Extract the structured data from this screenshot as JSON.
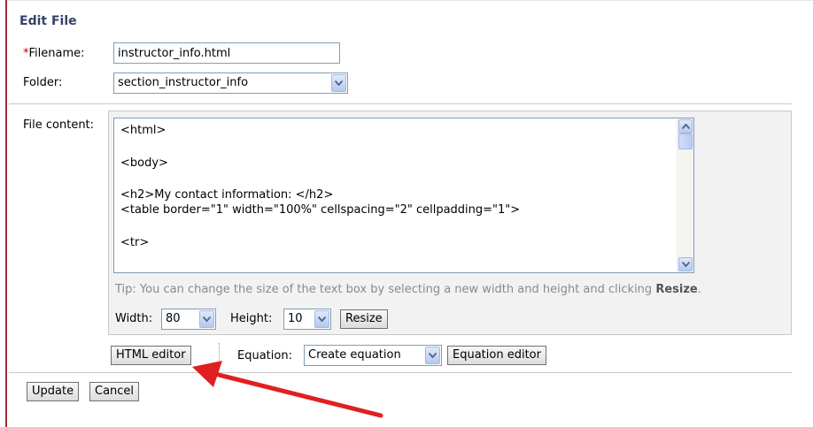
{
  "page": {
    "title": "Edit File"
  },
  "filename": {
    "required_marker": "*",
    "label": "Filename:",
    "value": "instructor_info.html"
  },
  "folder": {
    "label": "Folder:",
    "value": "section_instructor_info"
  },
  "file_content": {
    "label": "File content:",
    "lines": [
      "<html>",
      "<body>",
      "<h2>My contact information: </h2>",
      "<table border=\"1\" width=\"100%\" cellspacing=\"2\" cellpadding=\"1\">",
      "<tr>"
    ],
    "tip_prefix": "Tip: You can change the size of the text box by selecting a new width and height and clicking ",
    "tip_bold": "Resize",
    "tip_suffix": ".",
    "width_label": "Width:",
    "width_value": "80",
    "height_label": "Height:",
    "height_value": "10",
    "resize_label": "Resize"
  },
  "editor_bar": {
    "html_editor_label": "HTML editor",
    "equation_label": "Equation:",
    "equation_value": "Create equation",
    "equation_editor_label": "Equation editor"
  },
  "actions": {
    "update_label": "Update",
    "cancel_label": "Cancel"
  },
  "annotation": {
    "arrow_color": "#e02020"
  },
  "icons": [
    "chevron-down-icon",
    "scroll-up-icon",
    "scroll-down-icon",
    "annotation-arrow-icon"
  ]
}
